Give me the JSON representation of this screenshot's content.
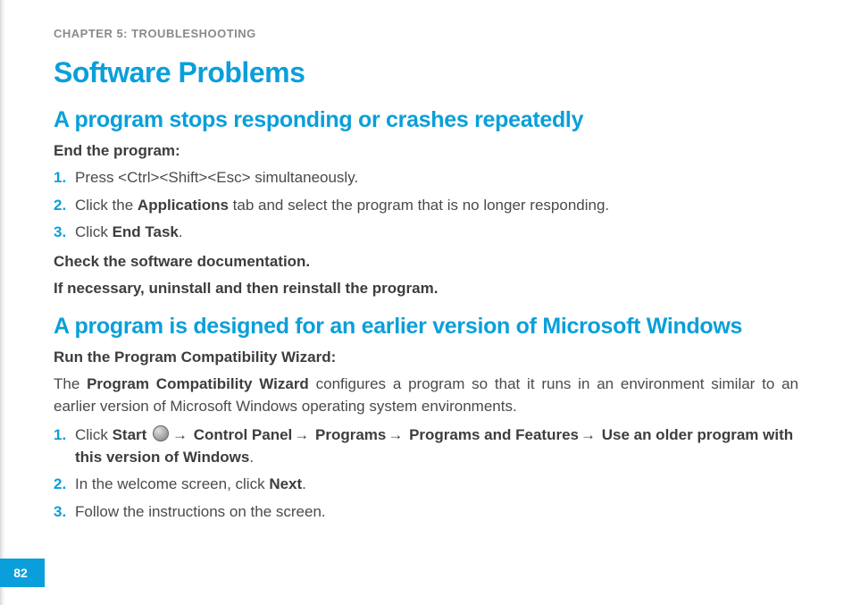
{
  "chapter_label": "CHAPTER 5: TROUBLESHOOTING",
  "title": "Software Problems",
  "section1": {
    "heading": "A program stops responding or crashes repeatedly",
    "lead": "End the program:",
    "steps": {
      "s1": "Press <Ctrl><Shift><Esc> simultaneously.",
      "s2_a": "Click the ",
      "s2_b": "Applications",
      "s2_c": " tab and select the program that is no longer responding.",
      "s3_a": "Click ",
      "s3_b": "End Task",
      "s3_c": "."
    },
    "after1": "Check the software documentation.",
    "after2": "If necessary, uninstall and then reinstall the program."
  },
  "section2": {
    "heading": "A program is designed for an earlier version of Microsoft Windows",
    "lead": "Run the Program Compatibility Wizard:",
    "para_a": "The ",
    "para_b": "Program Compatibility Wizard",
    "para_c": " configures a program so that it runs in an environment similar to an earlier version of Microsoft Windows operating system environments.",
    "steps": {
      "s1_a": "Click ",
      "s1_b": "Start",
      "s1_arrow": "→",
      "s1_c": " Control Panel",
      "s1_d": " Programs",
      "s1_e": " Programs and Features",
      "s1_f": " Use an older program with this version of Windows",
      "s1_end": ".",
      "s2_a": "In the welcome screen, click ",
      "s2_b": "Next",
      "s2_c": ".",
      "s3": "Follow the instructions on the screen."
    }
  },
  "page_number": "82"
}
